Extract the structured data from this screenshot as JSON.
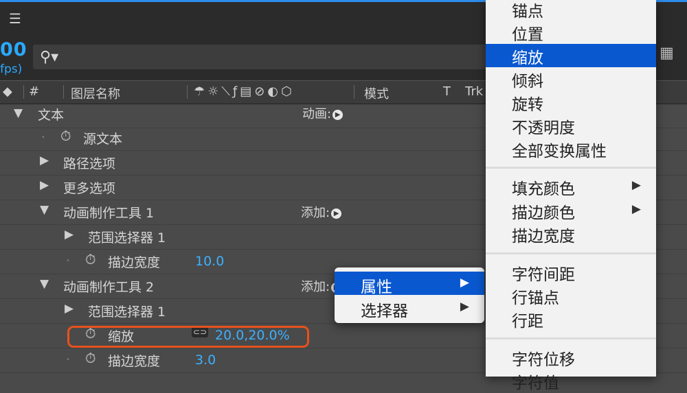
{
  "timecode": "00",
  "fps": "fps)",
  "header": {
    "col_num": "#",
    "col_name": "图层名称",
    "col_mode": "模式",
    "col_t": "T",
    "col_trk": "Trk"
  },
  "layers": {
    "text": "文本",
    "animate_label": "动画:",
    "source_text": "源文本",
    "path_options": "路径选项",
    "more_options": "更多选项",
    "animator1": "动画制作工具 1",
    "add_label": "添加:",
    "range_selector": "范围选择器 1",
    "stroke_width": "描边宽度",
    "stroke_width_value1": "10.0",
    "animator2": "动画制作工具 2",
    "scale": "缩放",
    "scale_value": "20.0,20.0%",
    "stroke_width_value2": "3.0"
  },
  "submenu": {
    "items": [
      {
        "label": "属性",
        "selected": true
      },
      {
        "label": "选择器",
        "selected": false
      }
    ]
  },
  "property_menu": {
    "items": [
      {
        "label": "锚点"
      },
      {
        "label": "位置"
      },
      {
        "label": "缩放",
        "selected": true
      },
      {
        "label": "倾斜"
      },
      {
        "label": "旋转"
      },
      {
        "label": "不透明度"
      },
      {
        "label": "全部变换属性"
      },
      {
        "label": "填充颜色",
        "has_submenu": true
      },
      {
        "label": "描边颜色",
        "has_submenu": true
      },
      {
        "label": "描边宽度"
      },
      {
        "label": "字符间距"
      },
      {
        "label": "行锚点"
      },
      {
        "label": "行距"
      },
      {
        "label": "字符位移"
      },
      {
        "label": "字符值"
      }
    ]
  },
  "colors": {
    "accent_blue": "#2aa9ff",
    "menu_selection": "#0a58d0",
    "highlight_ring": "#e8511d"
  }
}
